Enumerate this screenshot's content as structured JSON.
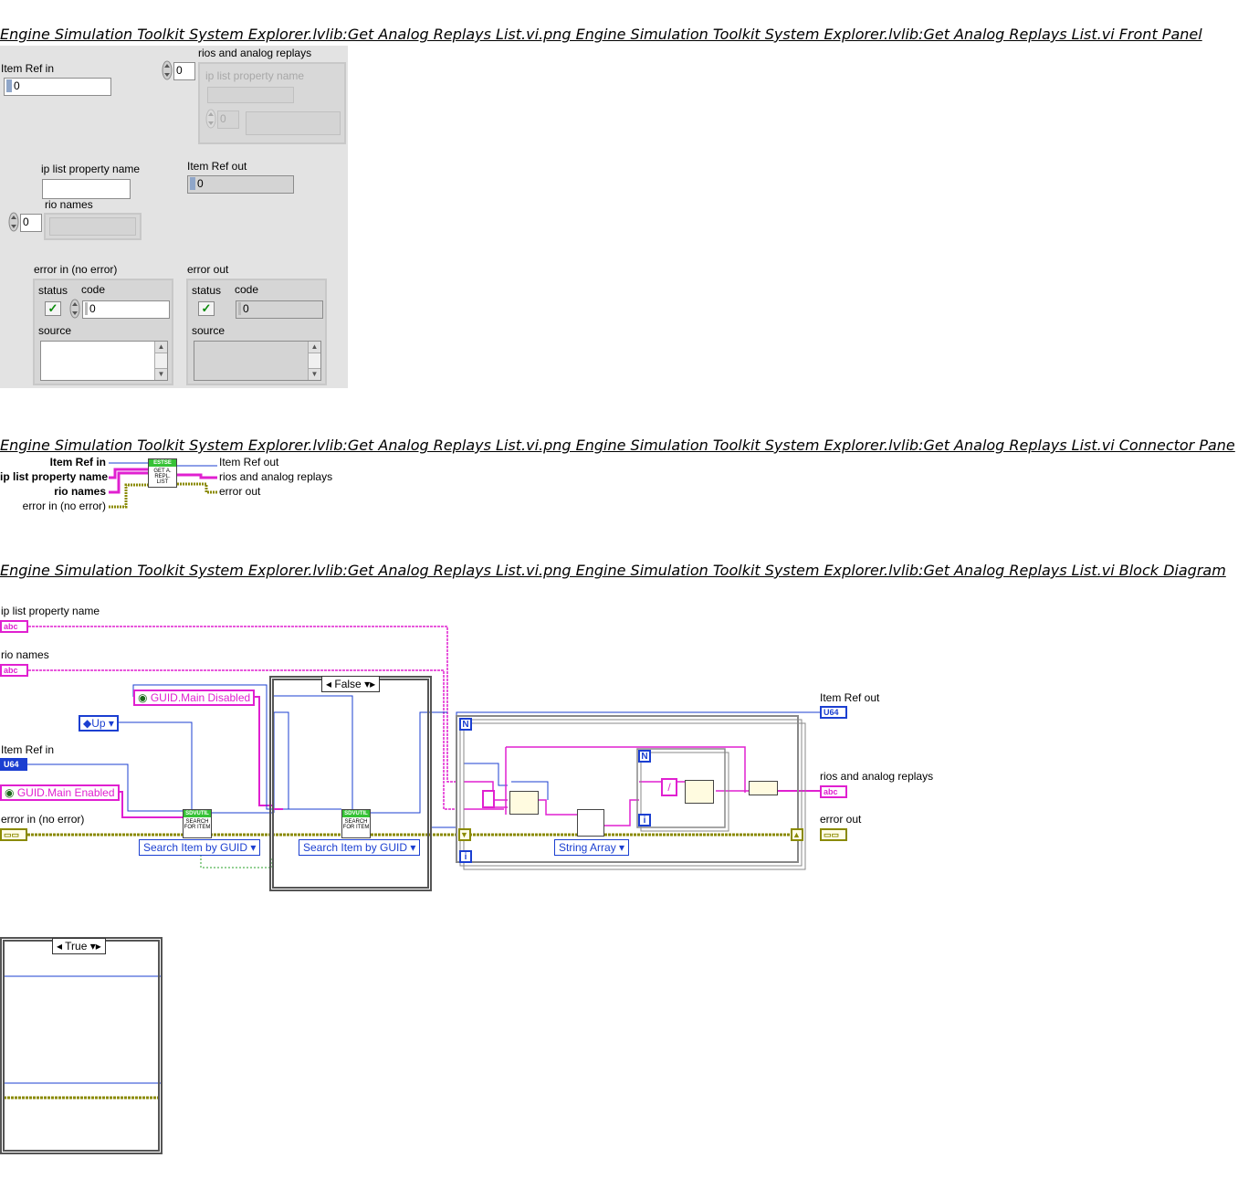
{
  "headings": {
    "front_panel": "Engine Simulation Toolkit System Explorer.lvlib:Get Analog Replays List.vi.png  Engine Simulation Toolkit System Explorer.lvlib:Get Analog Replays List.vi Front Panel",
    "connector_pane": "Engine Simulation Toolkit System Explorer.lvlib:Get Analog Replays List.vi.png  Engine Simulation Toolkit System Explorer.lvlib:Get Analog Replays List.vi Connector Pane",
    "block_diagram": "Engine Simulation Toolkit System Explorer.lvlib:Get Analog Replays List.vi.png  Engine Simulation Toolkit System Explorer.lvlib:Get Analog Replays List.vi Block Diagram"
  },
  "front_panel": {
    "item_ref_in": {
      "label": "Item Ref in",
      "value": "0"
    },
    "rios_and_analog_replays": {
      "label": "rios and analog replays",
      "index": "0",
      "inner_label": "ip list property name",
      "inner_index": "0"
    },
    "ip_list_property_name": {
      "label": "ip list property name"
    },
    "item_ref_out": {
      "label": "Item Ref out",
      "value": "0"
    },
    "rio_names": {
      "label": "rio names",
      "index": "0"
    },
    "error_in": {
      "label": "error in (no error)",
      "status_label": "status",
      "code_label": "code",
      "code_value": "0",
      "source_label": "source"
    },
    "error_out": {
      "label": "error out",
      "status_label": "status",
      "code_label": "code",
      "code_value": "0",
      "source_label": "source"
    }
  },
  "connector_pane": {
    "inputs": [
      "Item Ref in",
      "ip list property name",
      "rio names",
      "error in (no error)"
    ],
    "outputs": [
      "Item Ref out",
      "rios and analog replays",
      "error out"
    ],
    "icon_top": "ESTSE",
    "icon_text": "GET A. REPL. LIST"
  },
  "block_diagram": {
    "ip_list_property_name": "ip list property name",
    "rio_names": "rio names",
    "item_ref_in": "Item Ref in",
    "error_in": "error in (no error)",
    "item_ref_out": "Item Ref out",
    "rios_and_analog_replays": "rios and analog replays",
    "error_out": "error out",
    "terminal_str": "abc",
    "terminal_u64": "U64",
    "guid_main_disabled": "GUID.Main Disabled",
    "guid_main_enabled": "GUID.Main Enabled",
    "direction": "Up",
    "search_mode_1": "Search Item by GUID",
    "search_mode_2": "Search Item by GUID",
    "string_array": "String Array",
    "case_false": "False",
    "case_true": "True",
    "subvi_top": "SDVUTIL",
    "subvi_text": "SEARCH FOR ITEM",
    "loop_N": "N",
    "loop_i": "i",
    "slash": "/"
  }
}
